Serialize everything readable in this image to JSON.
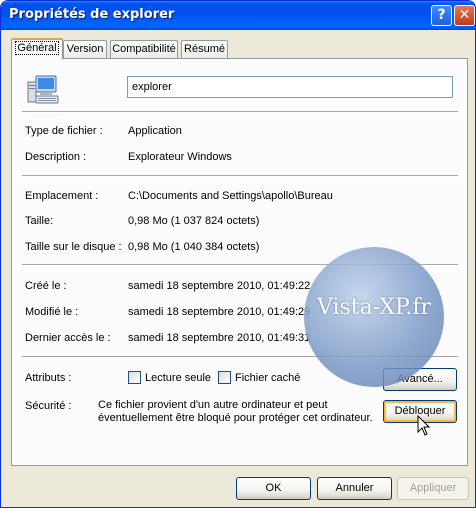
{
  "window": {
    "title": "Propriétés de explorer",
    "help_glyph": "?",
    "close_glyph": "✕"
  },
  "tabs": [
    {
      "label": "Général",
      "active": true
    },
    {
      "label": "Version",
      "active": false
    },
    {
      "label": "Compatibilité",
      "active": false
    },
    {
      "label": "Résumé",
      "active": false
    }
  ],
  "file": {
    "name": "explorer",
    "icon": "computer-icon"
  },
  "properties": {
    "type_label": "Type de fichier :",
    "type_value": "Application",
    "desc_label": "Description :",
    "desc_value": "Explorateur Windows",
    "location_label": "Emplacement :",
    "location_value": "C:\\Documents and Settings\\apollo\\Bureau",
    "size_label": "Taille:",
    "size_value": "0,98 Mo (1 037 824 octets)",
    "disk_label": "Taille sur le disque :",
    "disk_value": "0,98 Mo (1 040 384 octets)",
    "created_label": "Créé le :",
    "created_value": "samedi 18 septembre 2010, 01:49:22",
    "modified_label": "Modifié le :",
    "modified_value": "samedi 18 septembre 2010, 01:49:29",
    "accessed_label": "Dernier accès le :",
    "accessed_value": "samedi 18 septembre 2010, 01:49:31"
  },
  "attributes": {
    "label": "Attributs :",
    "readonly_label": "Lecture seule",
    "readonly_checked": false,
    "hidden_label": "Fichier caché",
    "hidden_checked": false,
    "advanced_button": "Avancé..."
  },
  "security": {
    "label": "Sécurité :",
    "line1": "Ce fichier provient d'un autre ordinateur et peut",
    "line2": "éventuellement être bloqué pour protéger cet ordinateur.",
    "unblock_button": "Débloquer"
  },
  "footer": {
    "ok": "OK",
    "cancel": "Annuler",
    "apply": "Appliquer",
    "apply_enabled": false
  },
  "watermark": {
    "text": "Vista-XP.fr"
  },
  "colors": {
    "titlebar": "#0054e3",
    "face": "#ece9d8",
    "panel": "#fcfcfe",
    "tab_highlight": "#f1a139"
  }
}
